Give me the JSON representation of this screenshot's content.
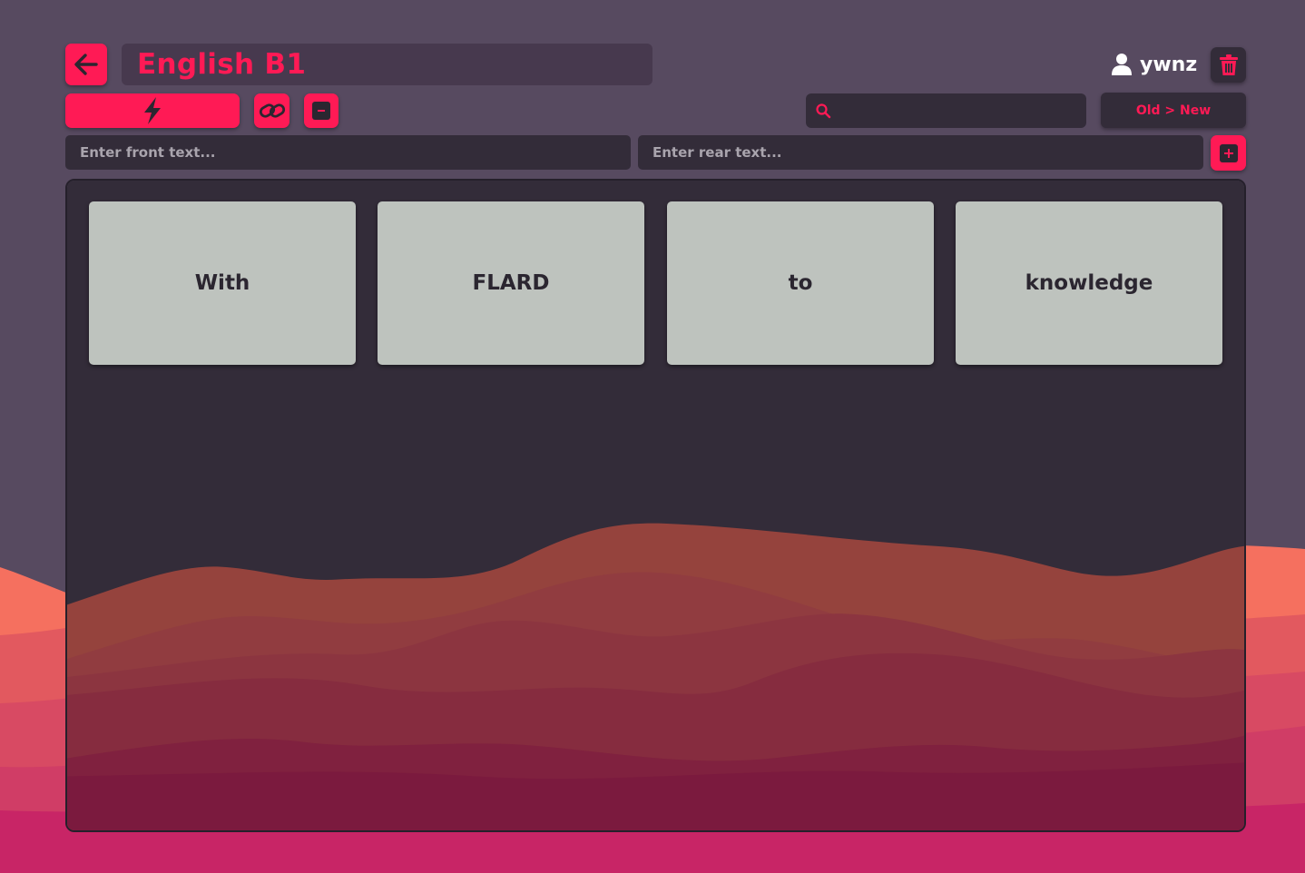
{
  "header": {
    "back_icon": "arrow-left-icon",
    "deck_title": "English B1",
    "user_icon": "user-icon",
    "username": "ywnz",
    "delete_icon": "trash-icon"
  },
  "toolbar": {
    "study_icon": "lightning-icon",
    "link_icon": "link-icon",
    "minimize_icon": "minus-square-icon",
    "search_icon": "search-icon",
    "search_value": "",
    "sort_label": "Old > New"
  },
  "new_card": {
    "front_placeholder": "Enter front text...",
    "rear_placeholder": "Enter rear text...",
    "add_icon": "plus-square-icon"
  },
  "cards": [
    {
      "front": "With"
    },
    {
      "front": "FLARD"
    },
    {
      "front": "to"
    },
    {
      "front": "knowledge"
    }
  ],
  "colors": {
    "accent": "#ff1a55",
    "background": "#574a60",
    "panel": "#332c39",
    "card": "#bec3be"
  }
}
